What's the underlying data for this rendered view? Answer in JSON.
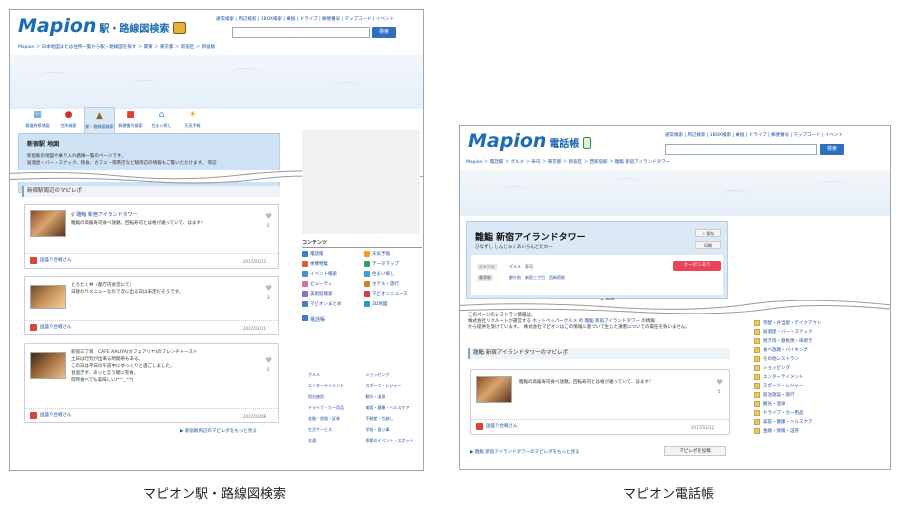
{
  "captions": {
    "left": "マピオン駅・路線図検索",
    "right": "マピオン電話帳"
  },
  "station": {
    "logo": "Mapion",
    "logo_sub": "駅・路線図検索",
    "top_links": "通常検索 | 周辺検索 | 1BOX検索 | 乗換 | ドライブ | 郵便番号 | マップコード | イベント",
    "search_button": "検索",
    "breadcrumb": "Mapion ＞ 日本地図または住所一覧から駅・路線図を探す ＞ 関東 ＞ 東京都 ＞ 新宿区 ＞ 新宿駅",
    "tabs": [
      {
        "label": "都道府県地図",
        "icon": "map-icon"
      },
      {
        "label": "住所検索",
        "icon": "pin-icon"
      },
      {
        "label": "駅・路線図検索",
        "icon": "train-icon"
      },
      {
        "label": "郵便番号検索",
        "icon": "postbox-icon"
      },
      {
        "label": "住まい探し",
        "icon": "house-icon"
      },
      {
        "label": "天気予報",
        "icon": "sun-icon"
      }
    ],
    "panel_title": "新宿駅 地図",
    "panel_text_1": "新宿駅の地図や乗り入れ路線一覧のページです。",
    "panel_text_2": "居酒屋・バー・スナック、和食、カフェ・喫茶店など駅周辺の情報もご覧いただけます。 周辺",
    "section_header": "新宿駅周辺のマピレポ",
    "cards": [
      {
        "title": "♀ 雛鮨 新宿アイランドタワー",
        "lines": [
          "雛鮨の高級寿司食べ放題。回転寿司とは格が違っていて、はます！"
        ],
        "likes": "5",
        "author": "国盛り合戦さん",
        "date": "2017/02/12"
      },
      {
        "title": "",
        "lines": [
          "とろたく丼（都庁内食堂にて）",
          "日替わりメニューなので次に出る日は未定だそうです。"
        ],
        "likes": "3",
        "author": "国盛り合戦さん",
        "date": "2017/02/11"
      },
      {
        "title": "",
        "lines": [
          "新宿三丁目　CAFE AALIYA(カフェアリヤ)のフレンチトースト",
          "土日は行列が出来る時間帯もある。",
          "この日は平日の午前中にゆっくりと過ごしました。",
          "甘過ぎず、あっと言う間に完食。",
          "何時食べても美味しい(*^_^*)"
        ],
        "likes": "5",
        "author": "国盛り合戦さん",
        "date": "2017/02/08"
      }
    ],
    "more_link": "▶ 新宿駅周辺のマピレポをもっと見る",
    "contents_header": "コンテンツ",
    "contents": [
      {
        "label": "電話帳",
        "color": "#3a7bd5"
      },
      {
        "label": "天気予報",
        "color": "#f0a020"
      },
      {
        "label": "季節特集",
        "color": "#e05a3a"
      },
      {
        "label": "データマップ",
        "color": "#2e9e6a"
      },
      {
        "label": "イベント検索",
        "color": "#4a8fd0"
      },
      {
        "label": "住まい探し",
        "color": "#3aa0d8"
      },
      {
        "label": "ビューティ",
        "color": "#e06aa0"
      },
      {
        "label": "ホテル・旅行",
        "color": "#d08030"
      },
      {
        "label": "美術館検索",
        "color": "#8a6ad0"
      },
      {
        "label": "マピオンニュース",
        "color": "#d04040"
      },
      {
        "label": "マピオンまとめ",
        "color": "#4a7ac0"
      },
      {
        "label": "3D地図",
        "color": "#2a9ac0"
      }
    ],
    "phonebook_header": "電話帳",
    "phonebook_items": [
      "グルメ",
      "ショッピング",
      "エンターテイメント",
      "スポーツ・レジャー",
      "宿泊施設",
      "観光・温泉",
      "ドライブ・カー用品",
      "美容・健康・ヘルスケア",
      "金融・保険・証券",
      "不動産・引越し",
      "生活サービス",
      "学校・習い事",
      "交通",
      "季節のイベント・スポット"
    ]
  },
  "phone": {
    "logo": "Mapion",
    "logo_sub": "電話帳",
    "top_links": "通常検索 | 周辺検索 | 1BOX検索 | 乗換 | ドライブ | 郵便番号 | マップコード | イベント",
    "search_button": "検索",
    "breadcrumb": "Mapion ＞ 電話帳 ＞ グルメ ＞ 寿司 ＞ 東京都 ＞ 新宿区 ＞ 西新宿駅 ＞ 雛鮨 新宿アイランドタワー",
    "title": "雛鮨 新宿アイランドタワー",
    "kana": "ひなずし しんじゅくあいらんどたわー",
    "save": "☆ 保存",
    "print": "印刷",
    "coupon": "クーポンあり",
    "genre_tag": "ジャンル",
    "genre_vals": "グルメ　寿司",
    "station_tag": "最寄駅",
    "station_vals": "都庁前　新宿三丁目　西新宿駅",
    "map_tab": "地図",
    "source_1": "このページのレストラン情報は、",
    "source_2a": "株式会社リクルートが運営する ",
    "source_2b": "ホットペッパーグルメ",
    "source_2c": " の ",
    "source_2d": "雛鮨 新宿アイランドタワー",
    "source_2e": " の情報",
    "source_3": "から提供を受けています。　株式会社マピオンはこの情報に基づいて生じた損害についての責任を負いません。",
    "section_header": "雛鮨 新宿アイランドタワーのマピレポ",
    "card": {
      "lines": [
        "雛鮨の高級寿司食べ放題。回転寿司とは格が違っていて、はます！"
      ],
      "likes": "5",
      "author": "国盛り合戦さん",
      "date": "2017/02/12"
    },
    "more_link": "▶ 雛鮨 新宿アイランドタワーのマピレポをもっと見る",
    "post_button": "マピレポを投稿",
    "right_list": [
      "宅配・弁当屋・テイクアウト",
      "居酒屋・バー・スナック",
      "焼き肉・鉄板焼・串焼き",
      "食べ放題・バイキング",
      "その他レストラン",
      "ショッピング",
      "エンターテイメント",
      "スポーツ・レジャー",
      "宿泊施設・旅行",
      "観光・温泉",
      "ドライブ・カー用品",
      "美容・健康・ヘルスケア",
      "金融・保険・証券"
    ]
  }
}
